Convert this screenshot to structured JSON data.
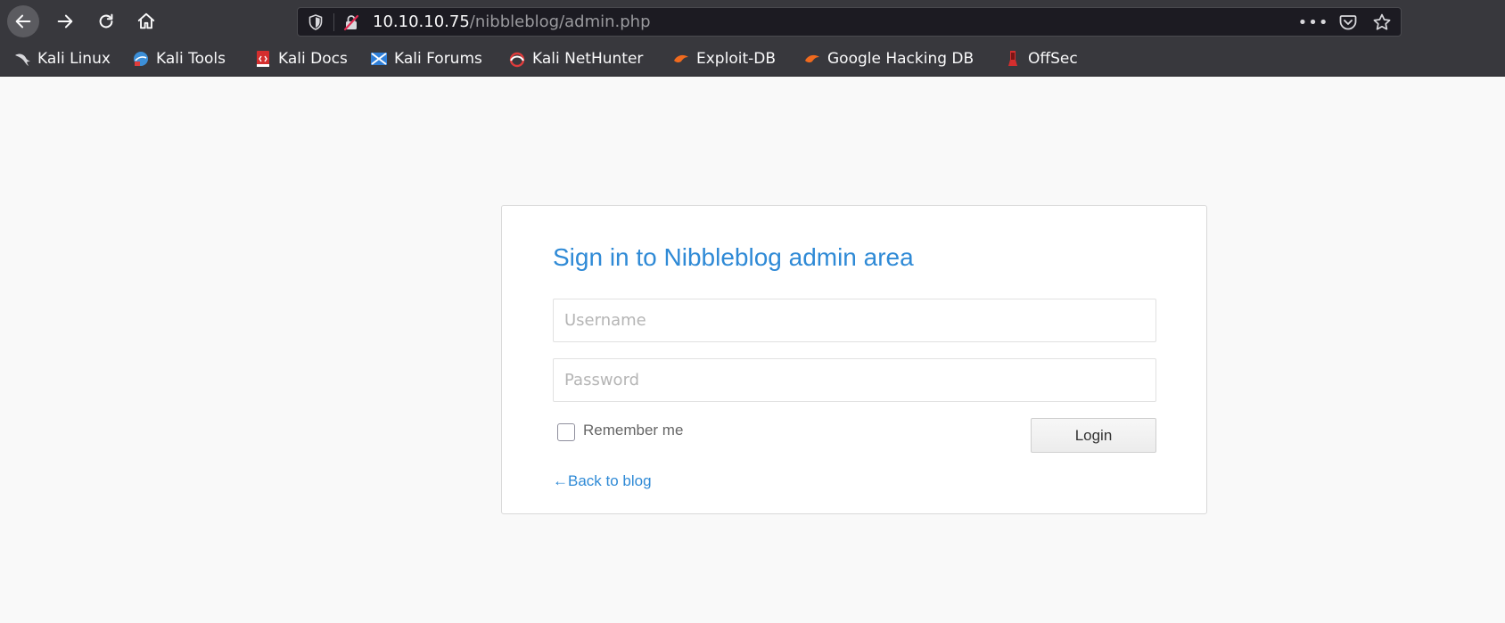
{
  "browser": {
    "url": {
      "host": "10.10.10.75",
      "path": "/nibbleblog/admin.php"
    },
    "overflow_glyph": "•••",
    "bookmarks": [
      {
        "label": "Kali Linux",
        "icon": "kali-dragon-icon"
      },
      {
        "label": "Kali Tools",
        "icon": "kali-tools-icon"
      },
      {
        "label": "Kali Docs",
        "icon": "kali-docs-icon"
      },
      {
        "label": "Kali Forums",
        "icon": "kali-forums-icon"
      },
      {
        "label": "Kali NetHunter",
        "icon": "kali-nethunter-icon"
      },
      {
        "label": "Exploit-DB",
        "icon": "exploit-db-icon"
      },
      {
        "label": "Google Hacking DB",
        "icon": "google-hacking-db-icon"
      },
      {
        "label": "OffSec",
        "icon": "offsec-icon"
      }
    ]
  },
  "login": {
    "title": "Sign in to Nibbleblog admin area",
    "username_placeholder": "Username",
    "password_placeholder": "Password",
    "remember_label": "Remember me",
    "login_button": "Login",
    "back_link": "←Back to blog"
  },
  "colors": {
    "accent": "#2f8ad6",
    "chrome": "#38383d",
    "page_bg": "#f9f9f9"
  }
}
